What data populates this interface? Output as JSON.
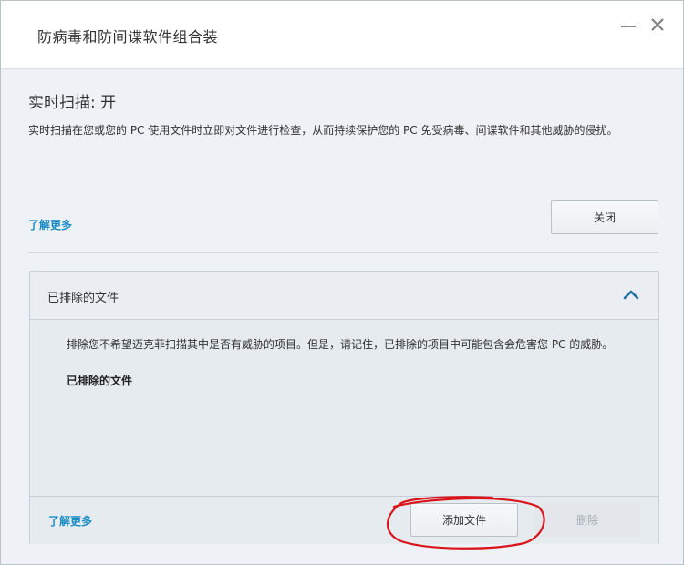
{
  "window": {
    "title": "防病毒和防间谍软件组合装",
    "minimize_icon": "minimize-icon",
    "close_icon": "close-icon"
  },
  "realtime_scan": {
    "title": "实时扫描: 开",
    "description": "实时扫描在您或您的 PC 使用文件时立即对文件进行检查，从而持续保护您的 PC 免受病毒、间谍软件和其他威胁的侵扰。",
    "learn_more": "了解更多",
    "turn_off_button": "关闭"
  },
  "excluded_files_panel": {
    "header": "已排除的文件",
    "expanded": true,
    "chevron_icon": "chevron-up-icon",
    "description": "排除您不希望迈克菲扫描其中是否有威胁的项目。但是，请记住，已排除的项目中可能包含会危害您 PC 的威胁。",
    "list_title": "已排除的文件",
    "learn_more": "了解更多",
    "add_file_button": "添加文件",
    "delete_button": "删除"
  },
  "colors": {
    "link": "#1a8bc4",
    "accent_chevron": "#1e6fa3",
    "annotation_circle": "#d9141b"
  }
}
